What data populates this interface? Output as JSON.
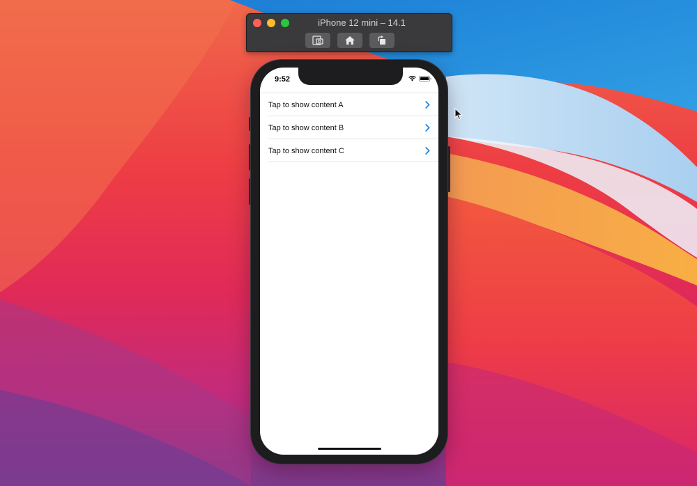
{
  "simulator": {
    "title": "iPhone 12 mini – 14.1",
    "toolbar": {
      "screenshot_icon": "camera-screenshot-icon",
      "home_icon": "home-icon",
      "rotate_icon": "rotate-icon"
    }
  },
  "status_bar": {
    "time": "9:52",
    "icons": [
      "wifi-icon",
      "battery-icon"
    ]
  },
  "list": {
    "items": [
      {
        "label": "Tap to show content A"
      },
      {
        "label": "Tap to show content B"
      },
      {
        "label": "Tap to show content C"
      }
    ],
    "chevron_icon": "chevron-right-icon"
  },
  "colors": {
    "accent": "#1d8ae5",
    "toolbar_bg": "#3a3a3c",
    "phone_frame": "#1d1d1f"
  }
}
